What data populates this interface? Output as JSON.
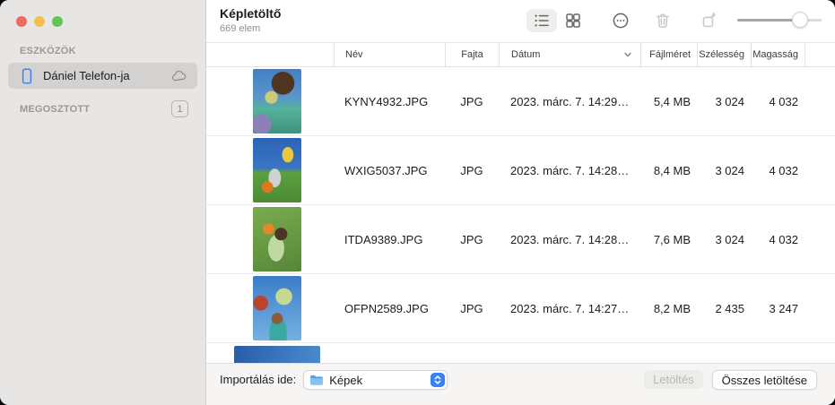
{
  "window": {
    "title": "Képletöltő",
    "subtitle": "669 elem"
  },
  "sidebar": {
    "devices_header": "ESZKÖZÖK",
    "device_name": "Dániel Telefon-ja",
    "shared_header": "MEGOSZTOTT",
    "shared_badge": "1"
  },
  "table": {
    "columns": {
      "name": "Név",
      "kind": "Fajta",
      "date": "Dátum",
      "size": "Fájlméret",
      "width": "Szélesség",
      "height": "Magasság"
    },
    "rows": [
      {
        "name": "KYNY4932.JPG",
        "kind": "JPG",
        "date": "2023. márc. 7. 14:29…",
        "size": "5,4 MB",
        "width": "3 024",
        "height": "4 032"
      },
      {
        "name": "WXIG5037.JPG",
        "kind": "JPG",
        "date": "2023. márc. 7. 14:28…",
        "size": "8,4 MB",
        "width": "3 024",
        "height": "4 032"
      },
      {
        "name": "ITDA9389.JPG",
        "kind": "JPG",
        "date": "2023. márc. 7. 14:28…",
        "size": "7,6 MB",
        "width": "3 024",
        "height": "4 032"
      },
      {
        "name": "OFPN2589.JPG",
        "kind": "JPG",
        "date": "2023. márc. 7. 14:27…",
        "size": "8,2 MB",
        "width": "2 435",
        "height": "3 247"
      }
    ]
  },
  "footer": {
    "import_label": "Importálás ide:",
    "destination": "Képek",
    "download_label": "Letöltés",
    "download_all_label": "Összes letöltése"
  },
  "colors": {
    "accent_blue": "#3b82f7",
    "sidebar_selection": "#d4d2d0",
    "traffic_red": "#ed6a5f",
    "traffic_yellow": "#f5bf4f",
    "traffic_green": "#61c554"
  }
}
